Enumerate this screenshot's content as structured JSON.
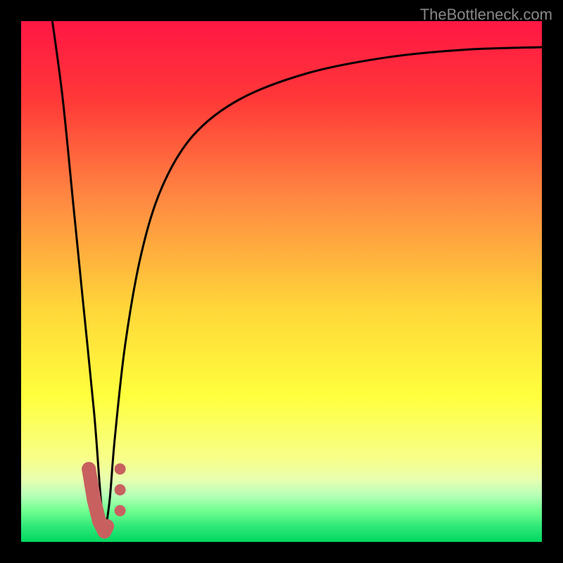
{
  "watermark": "TheBottleneck.com",
  "chart_data": {
    "type": "line",
    "title": "",
    "xlabel": "",
    "ylabel": "",
    "xlim": [
      0,
      100
    ],
    "ylim": [
      0,
      100
    ],
    "gradient_stops": [
      {
        "offset": 0,
        "color": "#ff1744"
      },
      {
        "offset": 15,
        "color": "#ff3838"
      },
      {
        "offset": 35,
        "color": "#ff8c42"
      },
      {
        "offset": 55,
        "color": "#ffd639"
      },
      {
        "offset": 72,
        "color": "#ffff3d"
      },
      {
        "offset": 84,
        "color": "#f8ff8a"
      },
      {
        "offset": 88,
        "color": "#e8ffb0"
      },
      {
        "offset": 91,
        "color": "#b8ffb8"
      },
      {
        "offset": 94,
        "color": "#70ff90"
      },
      {
        "offset": 97,
        "color": "#30e878"
      },
      {
        "offset": 100,
        "color": "#00d860"
      }
    ],
    "series": [
      {
        "name": "left-curve",
        "type": "line",
        "x": [
          6,
          8,
          10,
          12,
          14,
          15,
          15.5,
          16
        ],
        "y": [
          100,
          85,
          65,
          45,
          25,
          12,
          6,
          1
        ]
      },
      {
        "name": "right-curve",
        "type": "line",
        "x": [
          16,
          17,
          18,
          20,
          23,
          27,
          33,
          42,
          55,
          70,
          85,
          100
        ],
        "y": [
          1,
          8,
          20,
          38,
          55,
          68,
          78,
          85,
          90,
          93,
          94.5,
          95
        ]
      },
      {
        "name": "bottom-markers-left",
        "type": "scatter",
        "x": [
          13,
          13.5,
          14,
          14.5,
          15,
          15.5,
          16,
          16.5
        ],
        "y": [
          14,
          11,
          8,
          6,
          4,
          3,
          2,
          3
        ],
        "color": "#c86060",
        "size": 10
      },
      {
        "name": "bottom-markers-right",
        "type": "scatter",
        "x": [
          19,
          19,
          19
        ],
        "y": [
          6,
          10,
          14
        ],
        "color": "#c86060",
        "size": 8
      }
    ]
  }
}
